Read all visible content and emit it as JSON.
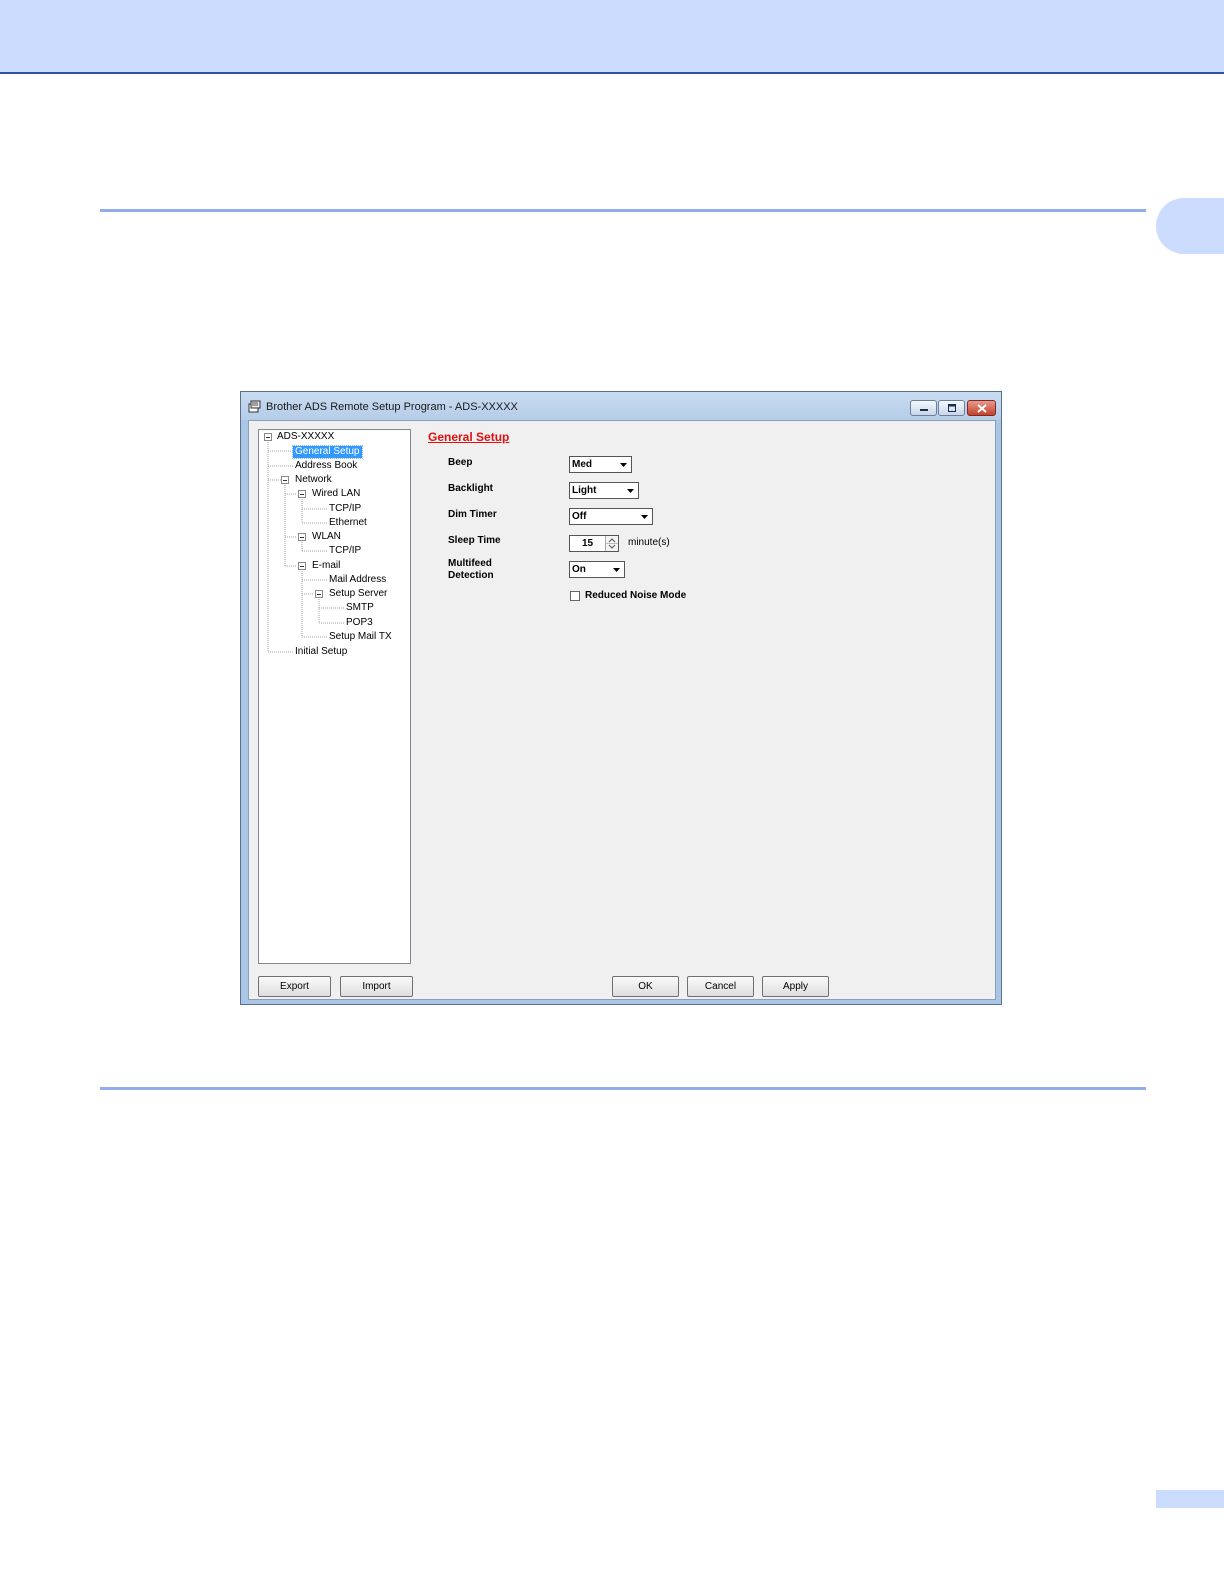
{
  "window": {
    "title": "Brother ADS Remote Setup Program - ADS-XXXXX"
  },
  "tree": {
    "items": [
      {
        "label": "ADS-XXXXX"
      },
      {
        "label": "General Setup"
      },
      {
        "label": "Address Book"
      },
      {
        "label": "Network"
      },
      {
        "label": "Wired LAN"
      },
      {
        "label": "TCP/IP"
      },
      {
        "label": "Ethernet"
      },
      {
        "label": "WLAN"
      },
      {
        "label": "TCP/IP"
      },
      {
        "label": "E-mail"
      },
      {
        "label": "Mail Address"
      },
      {
        "label": "Setup Server"
      },
      {
        "label": "SMTP"
      },
      {
        "label": "POP3"
      },
      {
        "label": "Setup Mail TX"
      },
      {
        "label": "Initial Setup"
      }
    ],
    "selected": "General Setup"
  },
  "panel": {
    "title": "General Setup",
    "beep": {
      "label": "Beep",
      "value": "Med"
    },
    "backlight": {
      "label": "Backlight",
      "value": "Light"
    },
    "dim_timer": {
      "label": "Dim Timer",
      "value": "Off"
    },
    "sleep_time": {
      "label": "Sleep Time",
      "value": "15",
      "unit": "minute(s)"
    },
    "multifeed": {
      "label_line1": "Multifeed",
      "label_line2": "Detection",
      "value": "On"
    },
    "reduced_noise": {
      "label": "Reduced Noise Mode",
      "checked": false
    }
  },
  "buttons": {
    "export": "Export",
    "import": "Import",
    "ok": "OK",
    "cancel": "Cancel",
    "apply": "Apply"
  },
  "colors": {
    "accent_band": "#ccdcff",
    "section_title": "#e01010",
    "selection": "#3399ff"
  }
}
